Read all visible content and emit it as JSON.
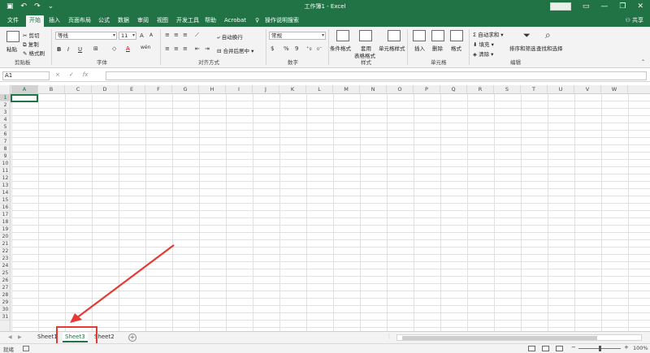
{
  "window": {
    "title": "工作簿1 - Excel",
    "share_label": "共享"
  },
  "menu": {
    "tabs": [
      "文件",
      "开始",
      "插入",
      "页面布局",
      "公式",
      "数据",
      "审阅",
      "视图",
      "开发工具",
      "帮助",
      "Acrobat"
    ],
    "active_tab": "开始",
    "search_hint": "操作说明搜索"
  },
  "ribbon": {
    "clipboard": {
      "paste": "粘贴",
      "cut": "剪切",
      "copy": "复制",
      "format_painter": "格式刷",
      "label": "剪贴板"
    },
    "font": {
      "font_name": "等线",
      "font_size": "11",
      "bold": "B",
      "italic": "I",
      "underline": "U",
      "grow": "A",
      "shrink": "A",
      "color_a": "A",
      "wen": "wén",
      "label": "字体"
    },
    "alignment": {
      "wrap_text": "自动换行",
      "merge_center": "合并后居中",
      "label": "对齐方式"
    },
    "number": {
      "format": "常规",
      "percent": "%",
      "comma": "9",
      "label": "数字"
    },
    "styles": {
      "conditional": "条件格式",
      "table_l1": "套用",
      "table_l2": "表格格式",
      "cell_styles": "单元格样式",
      "label": "样式"
    },
    "cells": {
      "insert": "插入",
      "delete": "删除",
      "format": "格式",
      "label": "单元格"
    },
    "editing": {
      "autosum": "自动求和",
      "fill": "填充",
      "clear": "清除",
      "sort": "排序和筛选",
      "find": "查找和选择",
      "label": "编辑"
    }
  },
  "formula_bar": {
    "name_box": "A1",
    "cancel": "×",
    "enter": "✓",
    "fx": "fx",
    "content": ""
  },
  "grid": {
    "columns": [
      "A",
      "B",
      "C",
      "D",
      "E",
      "F",
      "G",
      "H",
      "I",
      "J",
      "K",
      "L",
      "M",
      "N",
      "O",
      "P",
      "Q",
      "R",
      "S",
      "T",
      "U",
      "V",
      "W"
    ],
    "rows": [
      "1",
      "2",
      "3",
      "4",
      "5",
      "6",
      "7",
      "8",
      "9",
      "10",
      "11",
      "12",
      "13",
      "14",
      "15",
      "16",
      "17",
      "18",
      "19",
      "20",
      "21",
      "22",
      "23",
      "24",
      "25",
      "26",
      "27",
      "28",
      "29",
      "30",
      "31"
    ],
    "selected_cell": "A1"
  },
  "sheets": {
    "tabs": [
      "Sheet1",
      "Sheet3",
      "Sheet2"
    ],
    "active": "Sheet3",
    "add_label": "+"
  },
  "status": {
    "ready": "就绪",
    "zoom": "100%"
  },
  "colors": {
    "brand": "#217346",
    "highlight": "#e53935"
  }
}
